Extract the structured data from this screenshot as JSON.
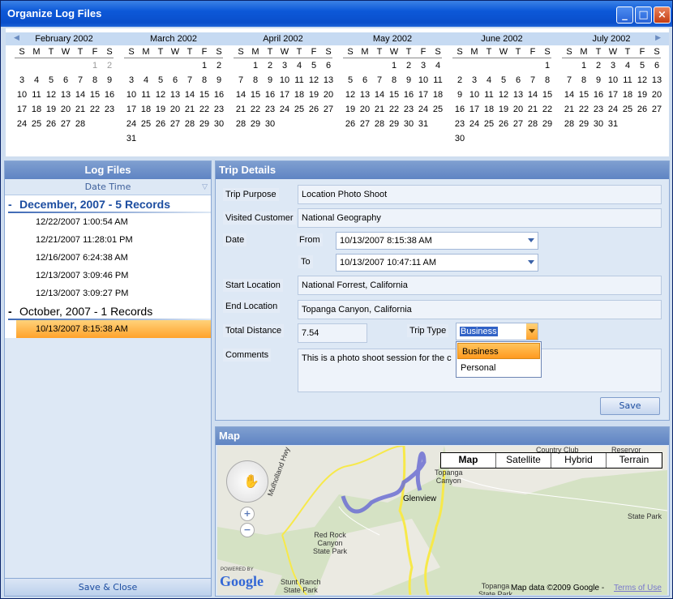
{
  "window": {
    "title": "Organize Log Files"
  },
  "calendar": {
    "dow": [
      "S",
      "M",
      "T",
      "W",
      "T",
      "F",
      "S"
    ],
    "months": [
      {
        "name": "February 2002",
        "weeks": [
          [
            "",
            "",
            "",
            "",
            "",
            "1",
            "2"
          ],
          [
            "3",
            "4",
            "5",
            "6",
            "7",
            "8",
            "9"
          ],
          [
            "10",
            "11",
            "12",
            "13",
            "14",
            "15",
            "16"
          ],
          [
            "17",
            "18",
            "19",
            "20",
            "21",
            "22",
            "23"
          ],
          [
            "24",
            "25",
            "26",
            "27",
            "28",
            "",
            ""
          ],
          [
            "",
            "",
            "",
            "",
            "",
            "",
            ""
          ]
        ]
      },
      {
        "name": "March 2002",
        "weeks": [
          [
            "",
            "",
            "",
            "",
            "",
            "1",
            "2"
          ],
          [
            "3",
            "4",
            "5",
            "6",
            "7",
            "8",
            "9"
          ],
          [
            "10",
            "11",
            "12",
            "13",
            "14",
            "15",
            "16"
          ],
          [
            "17",
            "18",
            "19",
            "20",
            "21",
            "22",
            "23"
          ],
          [
            "24",
            "25",
            "26",
            "27",
            "28",
            "29",
            "30"
          ],
          [
            "31",
            "",
            "",
            "",
            "",
            "",
            ""
          ]
        ]
      },
      {
        "name": "April 2002",
        "weeks": [
          [
            "",
            "1",
            "2",
            "3",
            "4",
            "5",
            "6"
          ],
          [
            "7",
            "8",
            "9",
            "10",
            "11",
            "12",
            "13"
          ],
          [
            "14",
            "15",
            "16",
            "17",
            "18",
            "19",
            "20"
          ],
          [
            "21",
            "22",
            "23",
            "24",
            "25",
            "26",
            "27"
          ],
          [
            "28",
            "29",
            "30",
            "",
            "",
            "",
            ""
          ],
          [
            "",
            "",
            "",
            "",
            "",
            "",
            ""
          ]
        ]
      },
      {
        "name": "May 2002",
        "weeks": [
          [
            "",
            "",
            "",
            "1",
            "2",
            "3",
            "4"
          ],
          [
            "5",
            "6",
            "7",
            "8",
            "9",
            "10",
            "11"
          ],
          [
            "12",
            "13",
            "14",
            "15",
            "16",
            "17",
            "18"
          ],
          [
            "19",
            "20",
            "21",
            "22",
            "23",
            "24",
            "25"
          ],
          [
            "26",
            "27",
            "28",
            "29",
            "30",
            "31",
            ""
          ],
          [
            "",
            "",
            "",
            "",
            "",
            "",
            ""
          ]
        ]
      },
      {
        "name": "June 2002",
        "weeks": [
          [
            "",
            "",
            "",
            "",
            "",
            "",
            "1"
          ],
          [
            "2",
            "3",
            "4",
            "5",
            "6",
            "7",
            "8"
          ],
          [
            "9",
            "10",
            "11",
            "12",
            "13",
            "14",
            "15"
          ],
          [
            "16",
            "17",
            "18",
            "19",
            "20",
            "21",
            "22"
          ],
          [
            "23",
            "24",
            "25",
            "26",
            "27",
            "28",
            "29"
          ],
          [
            "30",
            "",
            "",
            "",
            "",
            "",
            ""
          ]
        ]
      },
      {
        "name": "July 2002",
        "weeks": [
          [
            "",
            "1",
            "2",
            "3",
            "4",
            "5",
            "6"
          ],
          [
            "7",
            "8",
            "9",
            "10",
            "11",
            "12",
            "13"
          ],
          [
            "14",
            "15",
            "16",
            "17",
            "18",
            "19",
            "20"
          ],
          [
            "21",
            "22",
            "23",
            "24",
            "25",
            "26",
            "27"
          ],
          [
            "28",
            "29",
            "30",
            "31",
            "",
            "",
            ""
          ],
          [
            "",
            "",
            "",
            "",
            "",
            "",
            ""
          ]
        ]
      }
    ]
  },
  "logfiles": {
    "title": "Log Files",
    "column": "Date Time",
    "groups": [
      {
        "label": "December, 2007 - 5 Records",
        "toggle": "-",
        "records": [
          "12/22/2007 1:00:54 AM",
          "12/21/2007 11:28:01 PM",
          "12/16/2007 6:24:38 AM",
          "12/13/2007 3:09:46 PM",
          "12/13/2007 3:09:27 PM"
        ]
      },
      {
        "label": "October, 2007 - 1 Records",
        "toggle": "-",
        "records": [
          "10/13/2007 8:15:38 AM"
        ]
      }
    ],
    "save_close": "Save & Close"
  },
  "trip": {
    "title": "Trip Details",
    "purpose_label": "Trip Purpose",
    "purpose": "Location Photo Shoot",
    "customer_label": "Visited Customer",
    "customer": "National Geography",
    "date_label": "Date",
    "from_label": "From",
    "from": "10/13/2007 8:15:38 AM",
    "to_label": "To",
    "to": "10/13/2007 10:47:11 AM",
    "start_label": "Start Location",
    "start": "National Forrest, California",
    "end_label": "End Location",
    "end": "Topanga Canyon, California",
    "distance_label": "Total Distance",
    "distance": "7.54",
    "type_label": "Trip Type",
    "type": "Business",
    "type_options": [
      "Business",
      "Personal"
    ],
    "comments_label": "Comments",
    "comments": "This is a photo shoot session for the c",
    "save": "Save"
  },
  "map": {
    "title": "Map",
    "types": [
      "Map",
      "Satellite",
      "Hybrid",
      "Terrain"
    ],
    "places": {
      "country_club": "Country Club",
      "reservoir": "Reservor",
      "topanga": "Topanga\nCanyon",
      "glenview": "Glenview",
      "state_park": "State Park",
      "mulholland": "Mulholland Hwy",
      "red_rock": "Red Rock\nCanyon\nState Park",
      "stunt_ranch": "Stunt Ranch\nState Park",
      "topanga2": "Topanga\nState Park"
    },
    "powered_by": "POWERED BY",
    "google": "Google",
    "attribution": "Map data ©2009 Google -",
    "terms": "Terms of Use"
  }
}
